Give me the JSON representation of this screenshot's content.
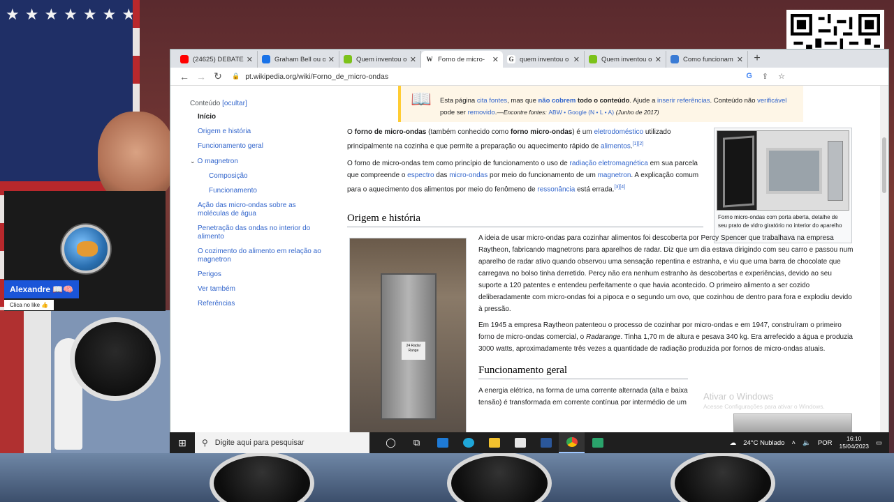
{
  "overlay": {
    "streamer_name": "Alexandre",
    "streamer_badge": "📖🧠",
    "like_prompt": "Clica no like 👍"
  },
  "browser": {
    "tabs": [
      {
        "title": "(24625) DEBATE",
        "favicon_color": "#ff0000",
        "active": false
      },
      {
        "title": "Graham Bell ou o",
        "favicon_color": "#1a73e8",
        "active": false
      },
      {
        "title": "Quem inventou o",
        "favicon_color": "#7cc21a",
        "active": false
      },
      {
        "title": "Forno de micro-",
        "favicon_color": "#ffffff",
        "favicon_glyph": "W",
        "active": true
      },
      {
        "title": "quem inventou o",
        "favicon_color": "#ffffff",
        "favicon_glyph": "G",
        "active": false
      },
      {
        "title": "Quem inventou o",
        "favicon_color": "#7cc21a",
        "active": false
      },
      {
        "title": "Como funcionam",
        "favicon_color": "#3a7bd5",
        "active": false
      }
    ],
    "new_tab": "+",
    "url": "pt.wikipedia.org/wiki/Forno_de_micro-ondas"
  },
  "notice": {
    "pre": "Esta página ",
    "link1": "cita fontes",
    "mid1": ", mas que ",
    "bold1": "não cobrem",
    "mid2": " todo o conteúdo",
    "mid3": ". Ajude a ",
    "link2": "inserir referências",
    "mid4": ". Conteúdo não ",
    "link3": "verificável",
    "mid5": " pode ser ",
    "link4": "removido",
    "mid6": ".—",
    "find": "Encontre fontes:",
    "sources": "ABW • Google (N • L • A)",
    "date": "(Junho de 2017)"
  },
  "toc": {
    "heading": "Conteúdo",
    "hide": "[ocultar]",
    "items": [
      {
        "label": "Início",
        "level": "first"
      },
      {
        "label": "Origem e história",
        "level": "1"
      },
      {
        "label": "Funcionamento geral",
        "level": "1"
      },
      {
        "label": "O magnetron",
        "level": "parent"
      },
      {
        "label": "Composição",
        "level": "sub"
      },
      {
        "label": "Funcionamento",
        "level": "sub"
      },
      {
        "label": "Ação das micro-ondas sobre as moléculas de água",
        "level": "1"
      },
      {
        "label": "Penetração das ondas no interior do alimento",
        "level": "1"
      },
      {
        "label": "O cozimento do alimento em relação ao magnetron",
        "level": "1"
      },
      {
        "label": "Perigos",
        "level": "1"
      },
      {
        "label": "Ver também",
        "level": "1"
      },
      {
        "label": "Referências",
        "level": "1"
      }
    ]
  },
  "article": {
    "p1": {
      "a": "O ",
      "b1": "forno de micro-ondas",
      "c": " (também conhecido como ",
      "b2": "forno micro-ondas",
      "d": ") é um ",
      "l1": "eletrodoméstico",
      "e": " utilizado principalmente na cozinha e que permite a preparação ou aquecimento rápido de ",
      "l2": "alimentos",
      "f": ".",
      "ref": "[1][2]"
    },
    "p2": {
      "a": "O forno de micro-ondas tem como princípio de funcionamento o uso de ",
      "l1": "radiação eletromagnética",
      "b": " em sua parcela que compreende o ",
      "l2": "espectro",
      "c": " das ",
      "l3": "micro-ondas",
      "d": " por meio do funcionamento de um ",
      "l4": "magnetron",
      "e": ". A explicação comum para o aquecimento dos alimentos por meio do fenômeno de ",
      "l5": "ressonância",
      "f": " está errada.",
      "ref": "[3][4]"
    },
    "h_origin": "Origem e história",
    "h_func": "Funcionamento geral",
    "origin_p1": {
      "a": "A ideia de usar micro-ondas para cozinhar alimentos foi descoberta por ",
      "l1": "Percy Spencer",
      "b": " que trabalhava na empresa ",
      "l2": "Raytheon",
      "c": ", fabricando magnetrons para aparelhos de ",
      "l3": "radar",
      "d": ". Diz que um dia estava dirigindo com seu carro e passou num aparelho de radar ativo quando observou uma sensação repentina e estranha, e viu que uma barra de chocolate que carregava no bolso tinha derretido. ",
      "l4": "Percy",
      "e": " não era nenhum estranho às descobertas e experiências, devido ao seu suporte a 120 ",
      "l5": "patentes",
      "f": " e entendeu perfeitamente o que havia acontecido. O primeiro alimento a ser cozido deliberadamente com micro-ondas foi a pipoca e o segundo um ovo, que cozinhou de dentro para fora e explodiu devido à pressão."
    },
    "origin_p2": {
      "a": "Em ",
      "l1": "1945",
      "b": " a empresa ",
      "l2": "Raytheon",
      "c": " patenteou o processo de cozinhar por micro-ondas e em ",
      "l3": "1947",
      "d": ", construíram o primeiro ",
      "l4": "forno",
      "e": " de micro-ondas comercial, o ",
      "i1": "Radarange",
      "f": ". Tinha 1,70 m de altura e pesava 340 kg. Era arrefecido a água e produzia 3000 watts, aproximadamente três vezes a quantidade de radiação produzida por fornos de micro-ondas atuais."
    },
    "func_p1": {
      "a": "A ",
      "l1": "energia elétrica",
      "b": ", na forma de uma ",
      "l2": "corrente alternada",
      "c": " (alta e baixa tensão) é transformada em ",
      "l3": "corrente contínua",
      "d": " por intermédio de um"
    },
    "infobox_caption": "Forno micro-ondas com porta aberta, detalhe de seu prato de vidro giratório no interior do aparelho",
    "photo_label": "24 Radar Range"
  },
  "watermark": {
    "title": "Ativar o Windows",
    "subtitle": "Acesse Configurações para ativar o Windows."
  },
  "taskbar": {
    "search_placeholder": "Digite aqui para pesquisar",
    "weather": "24°C Nublado",
    "lang": "POR",
    "time": "16:10",
    "date": "15/04/2023"
  }
}
